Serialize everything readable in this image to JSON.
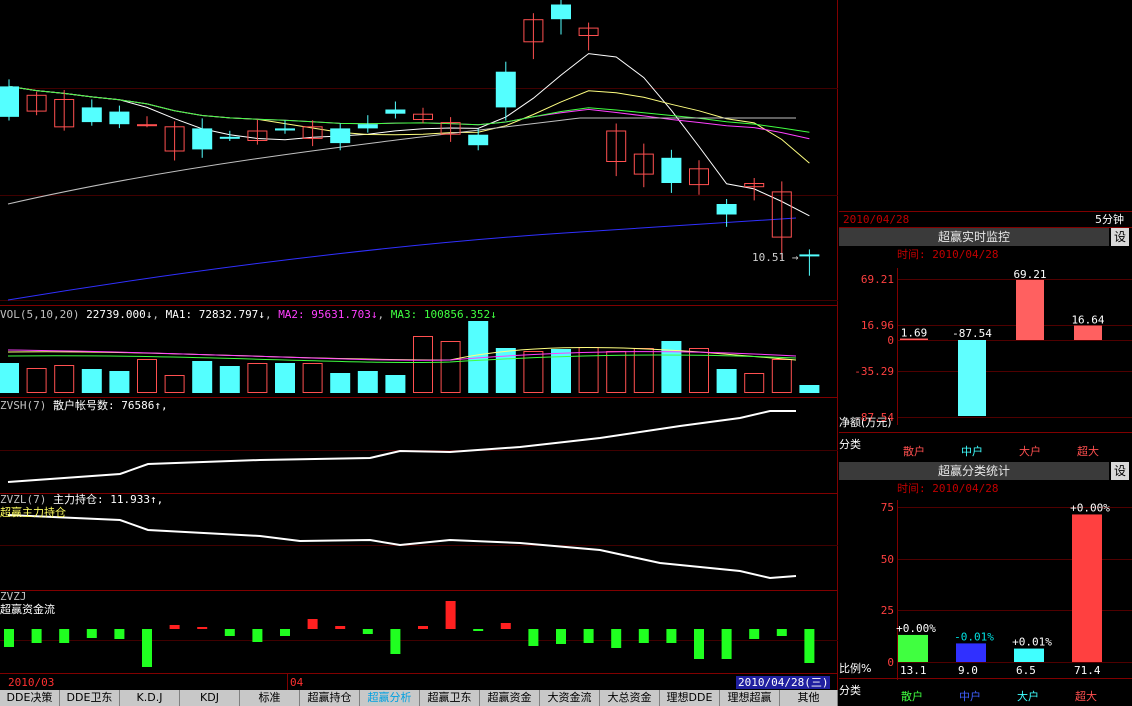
{
  "colors": {
    "up": "#ff5050",
    "down": "#54ffff",
    "grid": "#800000",
    "ma5": "#ffffff",
    "ma10": "#ffff80",
    "ma20": "#ff40ff",
    "ma30": "#40ff40",
    "ma60": "#c0c0c0",
    "ma120": "#3030ff"
  },
  "price": {
    "low_marker": "10.51"
  },
  "vol": {
    "label": "VOL(5,10,20)",
    "value": "22739.000↓",
    "ma1": "MA1: 72832.797↓",
    "ma2": "MA2: 95631.703↓",
    "ma3": "MA3: 100856.352↓"
  },
  "zvsh": {
    "label": "ZVSH(7)",
    "name": "散户帐号数:",
    "value": "76586↑,"
  },
  "zvzl": {
    "label": "ZVZL(7)",
    "name": "主力持仓:",
    "value": "11.933↑,",
    "subtitle": "超赢主力持仓"
  },
  "zvzj": {
    "label": "ZVZJ",
    "subtitle": "超赢资金流"
  },
  "xaxis": {
    "left_date": "2010/03",
    "mid_label": "04",
    "cursor_date": "2010/04/28(三)"
  },
  "tabs": [
    "DDE决策",
    "DDE卫东",
    "K.D.J",
    "KDJ",
    "标准",
    "超赢持仓",
    "超赢分析",
    "超赢卫东",
    "超赢资金",
    "大资金流",
    "大总资金",
    "理想DDE",
    "理想超赢",
    "其他"
  ],
  "active_tab": "超赢分析",
  "right": {
    "date_header": "2010/04/28",
    "period": "5分钟",
    "monitor": {
      "title": "超赢实时监控",
      "settings": "设",
      "time_label": "时间: 2010/04/28",
      "axis_labels": [
        "69.21",
        "16.96",
        "0",
        "-35.29",
        "-87.54"
      ],
      "unit_label": "净额(万元)",
      "category_label": "分类",
      "bars": [
        {
          "cat": "散户",
          "value": 1.69,
          "label": "1.69",
          "color": "#ff6060"
        },
        {
          "cat": "中户",
          "value": -87.54,
          "label": "-87.54",
          "color": "#60ffff"
        },
        {
          "cat": "大户",
          "value": 69.21,
          "label": "69.21",
          "color": "#ff6060"
        },
        {
          "cat": "超大",
          "value": 16.64,
          "label": "16.64",
          "color": "#ff6060"
        }
      ]
    },
    "stats": {
      "title": "超赢分类统计",
      "settings": "设",
      "time_label": "时间: 2010/04/28",
      "axis_labels": [
        "75",
        "50",
        "25",
        "0"
      ],
      "ratio_label": "比例%",
      "category_label": "分类",
      "bars": [
        {
          "cat": "散户",
          "value": 13.1,
          "label": "13.1",
          "change": "+0.00%",
          "color": "#40ff40",
          "change_color": "#ffffff"
        },
        {
          "cat": "中户",
          "value": 9.0,
          "label": "9.0",
          "change": "-0.01%",
          "color": "#3030ff",
          "change_color": "#00e0e0"
        },
        {
          "cat": "大户",
          "value": 6.5,
          "label": "6.5",
          "change": "+0.01%",
          "color": "#40ffff",
          "change_color": "#ffffff"
        },
        {
          "cat": "超大",
          "value": 71.4,
          "label": "71.4",
          "change": "+0.00%",
          "color": "#ff4040",
          "change_color": "#ffffff"
        }
      ],
      "cat_colors": [
        "#40ff40",
        "#4060ff",
        "#40ffff",
        "#ff5050"
      ]
    }
  },
  "candles": [
    [
      1.5,
      7,
      16,
      -2,
      1
    ],
    [
      4,
      3,
      12,
      -2,
      0
    ],
    [
      -3.5,
      9,
      10,
      1,
      0
    ],
    [
      -1,
      8,
      6,
      -2,
      1
    ],
    [
      -2,
      6,
      4,
      -3,
      1
    ],
    [
      -2,
      8,
      -2,
      0,
      0
    ],
    [
      -3,
      5,
      -15,
      -20,
      0
    ],
    [
      -4,
      10,
      -14,
      -18,
      1
    ],
    [
      -8,
      6,
      -8,
      4,
      1
    ],
    [
      -10,
      11,
      -5,
      -2,
      0
    ],
    [
      -4,
      8,
      -5,
      -1,
      1
    ],
    [
      -3,
      6,
      -9,
      -14,
      0
    ],
    [
      -4,
      5,
      -11,
      -14,
      1
    ],
    [
      -2,
      9,
      -4,
      4,
      1
    ],
    [
      5,
      8,
      3,
      6,
      1
    ],
    [
      3,
      6,
      0,
      -1,
      0
    ],
    [
      -1,
      5,
      -7,
      -14,
      0
    ],
    [
      -7,
      6,
      -12,
      -7,
      1
    ],
    [
      6,
      10,
      23,
      34,
      1
    ],
    [
      37,
      6,
      48,
      46,
      0
    ],
    [
      48,
      6,
      55,
      41,
      1
    ],
    [
      40,
      5,
      44,
      38,
      0
    ],
    [
      -5,
      7,
      -20,
      -37,
      0
    ],
    [
      -16,
      10,
      -26,
      -32,
      0
    ],
    [
      -18,
      8,
      -30,
      -23,
      1
    ],
    [
      -23,
      8,
      -31,
      -22,
      0
    ],
    [
      -40,
      5,
      -45,
      -31,
      1
    ],
    [
      -30,
      5,
      -32,
      -34,
      0
    ],
    [
      -34,
      10,
      -56,
      -61,
      0
    ],
    [
      -64,
      5,
      -64,
      -61,
      1
    ]
  ]
}
